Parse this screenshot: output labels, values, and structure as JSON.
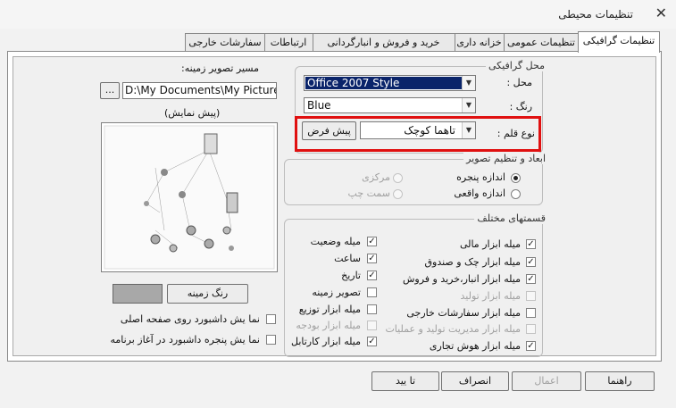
{
  "window": {
    "title": "تنظیمات محیطی",
    "close_glyph": "✕"
  },
  "tabs": [
    {
      "label": "تنظیمات گرافیکی"
    },
    {
      "label": "تنظیمات عمومی"
    },
    {
      "label": "خزانه داری"
    },
    {
      "label": "خرید و فروش و انبارگردانی"
    },
    {
      "label": "ارتباطات"
    },
    {
      "label": "سفارشات خارجی"
    }
  ],
  "wallpaper": {
    "path_label": "مسیر تصویر زمینه:",
    "path_value": "D:\\My Documents\\My Pictures\\I",
    "browse_label": "...",
    "preview_label": "(پیش نمایش)",
    "bgcolor_button": "رنگ زمینه",
    "bgcolor_swatch": "#a8a8a8",
    "options": [
      {
        "label": "نما یش داشبورد روی صفحه اصلی",
        "checked": false
      },
      {
        "label": "نما یش پنجره داشبورد در آغاز برنامه",
        "checked": false
      }
    ]
  },
  "graphics": {
    "legend": "محل گرافیکی",
    "location_label": "محل :",
    "location_value": "Office 2007 Style",
    "location_highlight": "#0a246a",
    "color_label": "رنگ :",
    "color_value": "Blue",
    "font_label": "نوع قلم :",
    "font_value": "تاهما کوچک",
    "default_button": "پیش فرض"
  },
  "image_settings": {
    "legend": "ابعاد و تنظیم تصویر",
    "options": [
      {
        "label": "اندازه پنجره",
        "selected": true,
        "enabled": true
      },
      {
        "label": "مرکزی",
        "selected": false,
        "enabled": false
      },
      {
        "label": "اندازه واقعی",
        "selected": false,
        "enabled": true
      },
      {
        "label": "سمت چپ",
        "selected": false,
        "enabled": false
      }
    ]
  },
  "sections": {
    "legend": "قسمتهای مختلف",
    "right": [
      {
        "label": "میله ابزار مالی",
        "checked": true,
        "enabled": true
      },
      {
        "label": "میله ابزار چک و صندوق",
        "checked": true,
        "enabled": true
      },
      {
        "label": "میله ابزار انبار،خرید و فروش",
        "checked": true,
        "enabled": true
      },
      {
        "label": "میله ابزار تولید",
        "checked": false,
        "enabled": false
      },
      {
        "label": "میله ابزار سفارشات خارجی",
        "checked": false,
        "enabled": true
      },
      {
        "label": "میله ابزار مدیریت تولید و عملیات",
        "checked": false,
        "enabled": false
      },
      {
        "label": "میله ابزار هوش تجاری",
        "checked": true,
        "enabled": true
      }
    ],
    "left": [
      {
        "label": "میله وضعیت",
        "checked": true,
        "enabled": true
      },
      {
        "label": "ساعت",
        "checked": true,
        "enabled": true
      },
      {
        "label": "تاریخ",
        "checked": true,
        "enabled": true
      },
      {
        "label": "تصویر زمینه",
        "checked": false,
        "enabled": true
      },
      {
        "label": "میله ابزار توزیع",
        "checked": false,
        "enabled": true
      },
      {
        "label": "میله ابزار بودجه",
        "checked": false,
        "enabled": false
      },
      {
        "label": "میله ابزار کارتابل",
        "checked": true,
        "enabled": true
      }
    ]
  },
  "footer": {
    "help": "راهنما",
    "apply": "اعمال",
    "cancel": "انصراف",
    "ok": "تا یید"
  }
}
